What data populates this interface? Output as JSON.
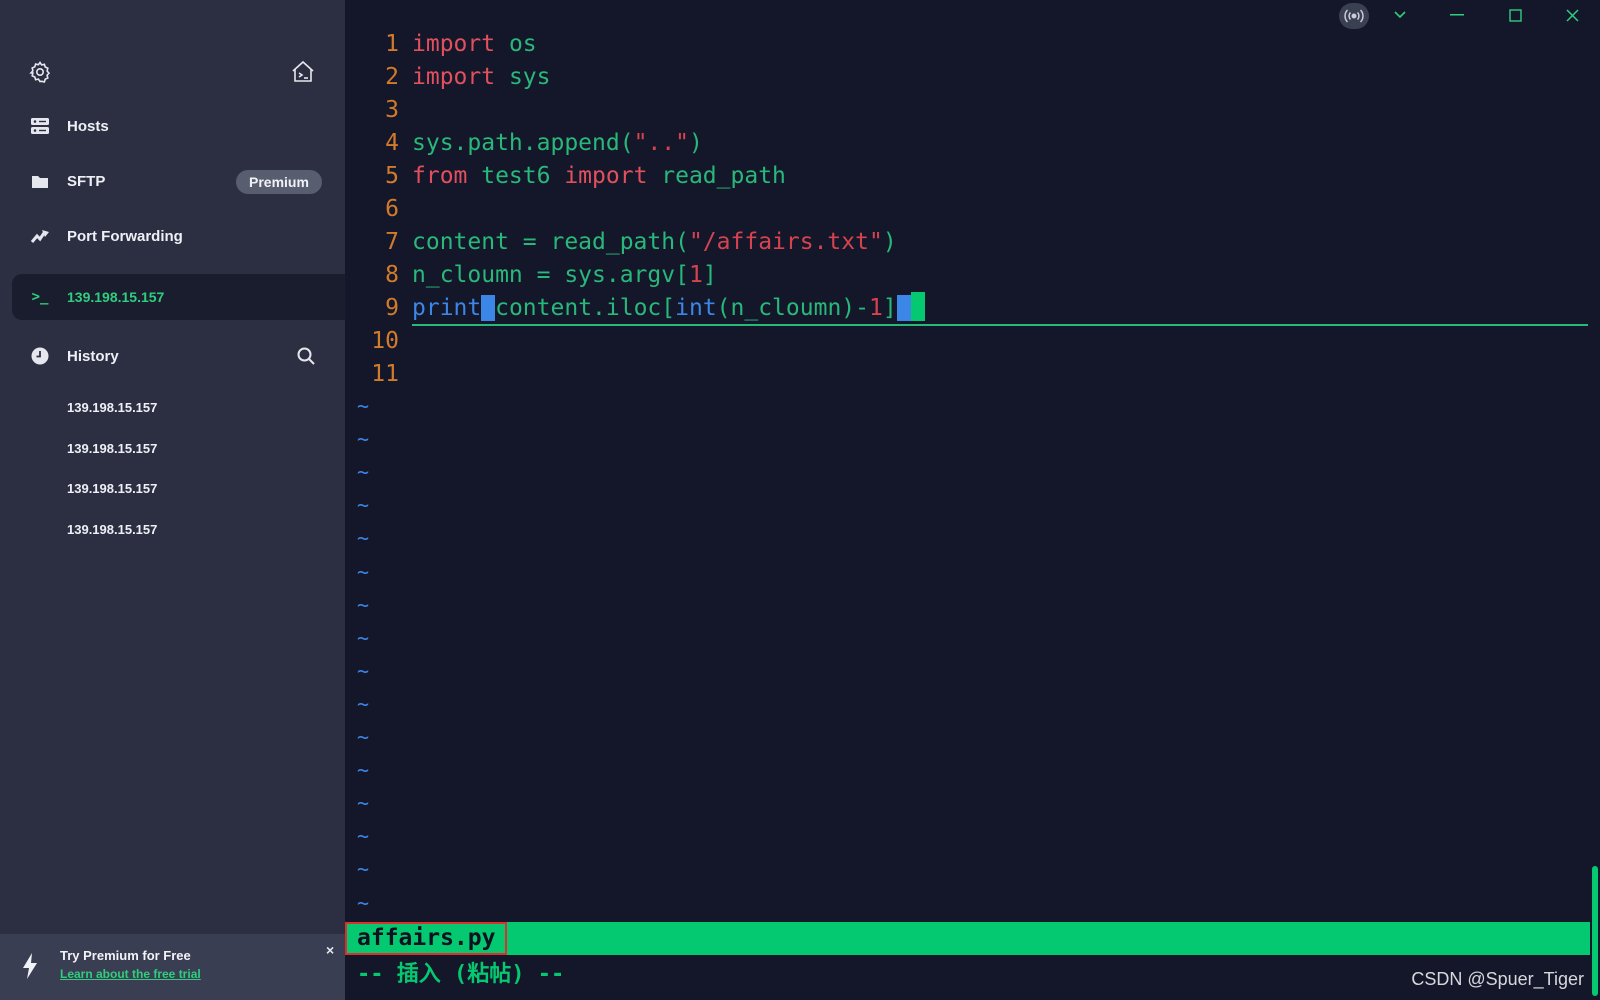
{
  "sidebar": {
    "nav": [
      {
        "label": "Hosts",
        "icon": "hosts-icon"
      },
      {
        "label": "SFTP",
        "icon": "folder-icon",
        "badge": "Premium"
      },
      {
        "label": "Port Forwarding",
        "icon": "port-forwarding-icon"
      }
    ],
    "active_session": {
      "label": "139.198.15.157",
      "icon": "terminal-icon"
    },
    "history": {
      "label": "History",
      "entries": [
        "139.198.15.157",
        "139.198.15.157",
        "139.198.15.157",
        "139.198.15.157"
      ]
    },
    "promo": {
      "title": "Try Premium for Free",
      "link": "Learn about the free trial",
      "close": "×"
    }
  },
  "editor": {
    "line_numbers": [
      "1",
      "2",
      "3",
      "4",
      "5",
      "6",
      "7",
      "8",
      "9",
      "10",
      "11"
    ],
    "lines": [
      [
        {
          "t": "import",
          "c": "kw"
        },
        {
          "t": " os",
          "c": "gr"
        }
      ],
      [
        {
          "t": "import",
          "c": "kw"
        },
        {
          "t": " sys",
          "c": "gr"
        }
      ],
      [],
      [
        {
          "t": "sys.path.append(",
          "c": "gr"
        },
        {
          "t": "\"..\"",
          "c": "str"
        },
        {
          "t": ")",
          "c": "gr"
        }
      ],
      [
        {
          "t": "from",
          "c": "kw"
        },
        {
          "t": " test6 ",
          "c": "gr"
        },
        {
          "t": "import",
          "c": "kw"
        },
        {
          "t": " read_path",
          "c": "gr"
        }
      ],
      [],
      [
        {
          "t": "content = read_path(",
          "c": "gr"
        },
        {
          "t": "\"/affairs.txt\"",
          "c": "str"
        },
        {
          "t": ")",
          "c": "gr"
        }
      ],
      [
        {
          "t": "n_cloumn = sys.argv[",
          "c": "gr"
        },
        {
          "t": "1",
          "c": "str"
        },
        {
          "t": "]",
          "c": "gr"
        }
      ],
      [
        {
          "t": "print",
          "c": "bl"
        },
        {
          "t": "(",
          "c": "bl",
          "hl": true
        },
        {
          "t": "content.iloc[",
          "c": "gr"
        },
        {
          "t": "int",
          "c": "bl"
        },
        {
          "t": "(n_cloumn)-",
          "c": "gr"
        },
        {
          "t": "1",
          "c": "str"
        },
        {
          "t": "]",
          "c": "gr"
        },
        {
          "t": ")",
          "c": "bl",
          "hl": true
        }
      ],
      [],
      []
    ],
    "tilde": "~",
    "tilde_count": 16,
    "status_filename": "affairs.py",
    "mode_text": "-- 插入 (粘帖) --"
  },
  "watermark": "CSDN @Spuer_Tiger"
}
